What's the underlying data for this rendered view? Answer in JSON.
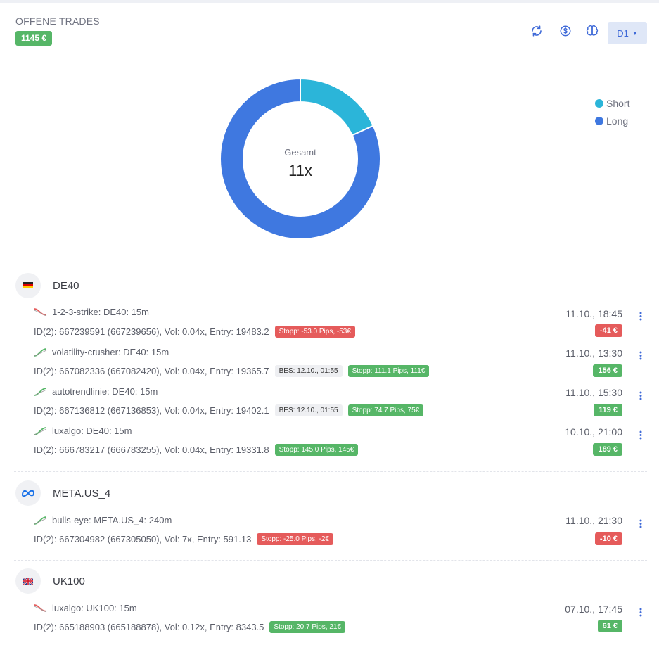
{
  "header": {
    "title": "OFFENE TRADES",
    "total": "1145 €",
    "timeframe": "D1"
  },
  "toolbar": {
    "icons": [
      "refresh-icon",
      "dollar-circle-icon",
      "brain-icon"
    ]
  },
  "chart_data": {
    "type": "pie",
    "donut": true,
    "center_label": "Gesamt",
    "center_value": "11x",
    "legend_position": "top-right",
    "series": [
      {
        "name": "Short",
        "value": 2,
        "color": "#2bb5d9"
      },
      {
        "name": "Long",
        "value": 9,
        "color": "#3f78e0"
      }
    ]
  },
  "groups": [
    {
      "name": "DE40",
      "icon": "germany-flag-icon",
      "trades": [
        {
          "name": "1-2-3-strike: DE40: 15m",
          "direction": "short",
          "detail": "ID(2): 667239591 (667239656), Vol: 0.04x, Entry: 19483.2",
          "bes": null,
          "stop": "Stopp: -53.0 Pips, -53€",
          "stop_color": "red",
          "time": "11.10., 18:45",
          "pnl": "-41 €",
          "pnl_color": "red"
        },
        {
          "name": "volatility-crusher: DE40: 15m",
          "direction": "long",
          "detail": "ID(2): 667082336 (667082420), Vol: 0.04x, Entry: 19365.7",
          "bes": "BES: 12.10., 01:55",
          "stop": "Stopp: 111.1 Pips, 111€",
          "stop_color": "green",
          "time": "11.10., 13:30",
          "pnl": "156 €",
          "pnl_color": "green"
        },
        {
          "name": "autotrendlinie: DE40: 15m",
          "direction": "long",
          "detail": "ID(2): 667136812 (667136853), Vol: 0.04x, Entry: 19402.1",
          "bes": "BES: 12.10., 01:55",
          "stop": "Stopp: 74.7 Pips, 75€",
          "stop_color": "green",
          "time": "11.10., 15:30",
          "pnl": "119 €",
          "pnl_color": "green"
        },
        {
          "name": "luxalgo: DE40: 15m",
          "direction": "long",
          "detail": "ID(2): 666783217 (666783255), Vol: 0.04x, Entry: 19331.8",
          "bes": null,
          "stop": "Stopp: 145.0 Pips, 145€",
          "stop_color": "green",
          "time": "10.10., 21:00",
          "pnl": "189 €",
          "pnl_color": "green"
        }
      ]
    },
    {
      "name": "META.US_4",
      "icon": "meta-logo-icon",
      "trades": [
        {
          "name": "bulls-eye: META.US_4: 240m",
          "direction": "long",
          "detail": "ID(2): 667304982 (667305050), Vol: 7x, Entry: 591.13",
          "bes": null,
          "stop": "Stopp: -25.0 Pips, -2€",
          "stop_color": "red",
          "time": "11.10., 21:30",
          "pnl": "-10 €",
          "pnl_color": "red"
        }
      ]
    },
    {
      "name": "UK100",
      "icon": "uk-flag-icon",
      "trades": [
        {
          "name": "luxalgo: UK100: 15m",
          "direction": "short",
          "detail": "ID(2): 665188903 (665188878), Vol: 0.12x, Entry: 8343.5",
          "bes": null,
          "stop": "Stopp: 20.7 Pips, 21€",
          "stop_color": "green",
          "time": "07.10., 17:45",
          "pnl": "61 €",
          "pnl_color": "green"
        }
      ]
    }
  ]
}
